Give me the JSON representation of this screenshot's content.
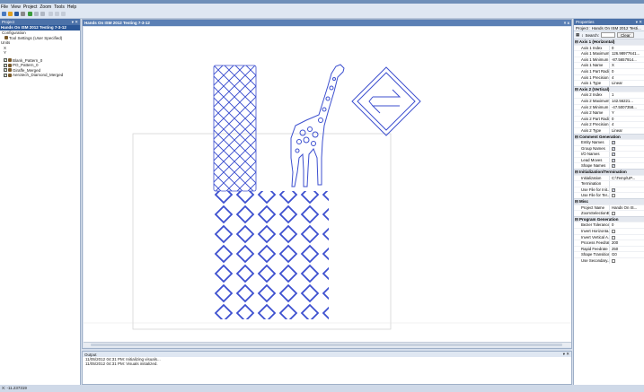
{
  "menu": [
    "File",
    "View",
    "Project",
    "Zoom",
    "Tools",
    "Help"
  ],
  "left_panel": {
    "header": "Project",
    "selected": "Hands On ISM 2012 Testing 7-3-12",
    "tree": [
      "Configuration",
      "Tool Settings (User Specified)",
      "Units",
      "X",
      "Y",
      "Blank_Pattern_0",
      "PO_Pattern_0",
      "Giraffe_Merged",
      "Aerotech_Diamond_Merged"
    ]
  },
  "document": {
    "title": "Hands On ISM 2012 Testing 7-3-12",
    "close": "× x"
  },
  "output": {
    "header": "Output",
    "lines": [
      "11/05/2012 04:31 PM: Initializing visuals...",
      "11/05/2012 04:31 PM: Visuals initialized."
    ]
  },
  "properties": {
    "header": "Properties",
    "object": "Project : Hands On ISM 2012 Testi...",
    "search_label": "Search:",
    "clear_label": "Clear",
    "categories": [
      {
        "name": "Axis 1 (Horizontal)",
        "rows": [
          {
            "k": "Axis 1 Index",
            "v": "0"
          },
          {
            "k": "Axis 1 Maximum",
            "v": "126.98977641..."
          },
          {
            "k": "Axis 1 Minimum",
            "v": "-87.5657914..."
          },
          {
            "k": "Axis 1 Name",
            "v": "X"
          },
          {
            "k": "Axis 1 Part Radius",
            "v": "0"
          },
          {
            "k": "Axis 1 Precision",
            "v": "4"
          },
          {
            "k": "Axis 1 Type",
            "v": "Linear"
          }
        ]
      },
      {
        "name": "Axis 2 (Vertical)",
        "rows": [
          {
            "k": "Axis 2 Index",
            "v": "1"
          },
          {
            "k": "Axis 2 Maximum",
            "v": "142.56221..."
          },
          {
            "k": "Axis 2 Minimum",
            "v": "-47.5007358..."
          },
          {
            "k": "Axis 2 Name",
            "v": "Y"
          },
          {
            "k": "Axis 2 Part Radius",
            "v": "0"
          },
          {
            "k": "Axis 2 Precision",
            "v": "4"
          },
          {
            "k": "Axis 2 Type",
            "v": "Linear"
          }
        ]
      },
      {
        "name": "Comment Generation",
        "rows": [
          {
            "k": "Entity Names",
            "check": true
          },
          {
            "k": "Group Names",
            "check": true
          },
          {
            "k": "I/O Names",
            "check": true
          },
          {
            "k": "Lead Moves",
            "check": true
          },
          {
            "k": "Shape Names",
            "check": true
          }
        ]
      },
      {
        "name": "Initialization/Termination",
        "rows": [
          {
            "k": "Initialization",
            "v": "C:\\Temp\\UP..."
          },
          {
            "k": "Termination",
            "v": ""
          },
          {
            "k": "Use File for Init...",
            "check": true
          },
          {
            "k": "Use File for Ter...",
            "check": false
          }
        ]
      },
      {
        "name": "Misc",
        "rows": [
          {
            "k": "Project Name",
            "v": "Hands On IS..."
          },
          {
            "k": "ZoomSelectionE...",
            "check": false
          }
        ]
      },
      {
        "name": "Program Generation",
        "rows": [
          {
            "k": "Bezier Tolerance",
            "v": "0"
          },
          {
            "k": "Invert Horizonta...",
            "check": false
          },
          {
            "k": "Invert Vertical A...",
            "check": false
          },
          {
            "k": "Process Feedrate",
            "v": "200"
          },
          {
            "k": "Rapid Feedrate",
            "v": "250"
          },
          {
            "k": "Shape Transitions",
            "v": "G0"
          },
          {
            "k": "Use Secondary...",
            "check": false
          }
        ]
      }
    ]
  },
  "status": "X: -11.237319",
  "colors": {
    "outline": "#3c4fcf",
    "header": "#4b71a8"
  }
}
